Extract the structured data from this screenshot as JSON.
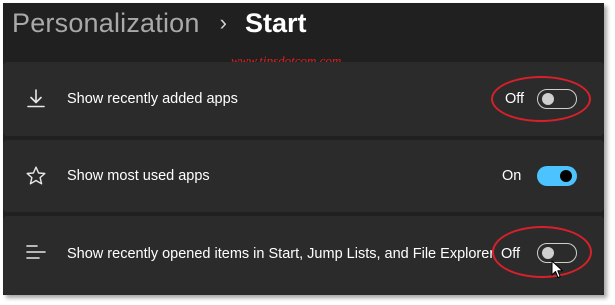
{
  "breadcrumb": {
    "parent": "Personalization",
    "separator": "›",
    "current": "Start"
  },
  "watermark": "www.tipsdotcom.com",
  "settings": [
    {
      "label": "Show recently added apps",
      "icon": "download-icon",
      "state_label": "Off",
      "on": false
    },
    {
      "label": "Show most used apps",
      "icon": "star-icon",
      "state_label": "On",
      "on": true
    },
    {
      "label": "Show recently opened items in Start, Jump Lists, and File Explorer",
      "icon": "list-icon",
      "state_label": "Off",
      "on": false
    }
  ],
  "colors": {
    "background": "#202020",
    "card": "#2b2b2b",
    "accent": "#4cc2ff",
    "annotation": "#d8202a"
  }
}
